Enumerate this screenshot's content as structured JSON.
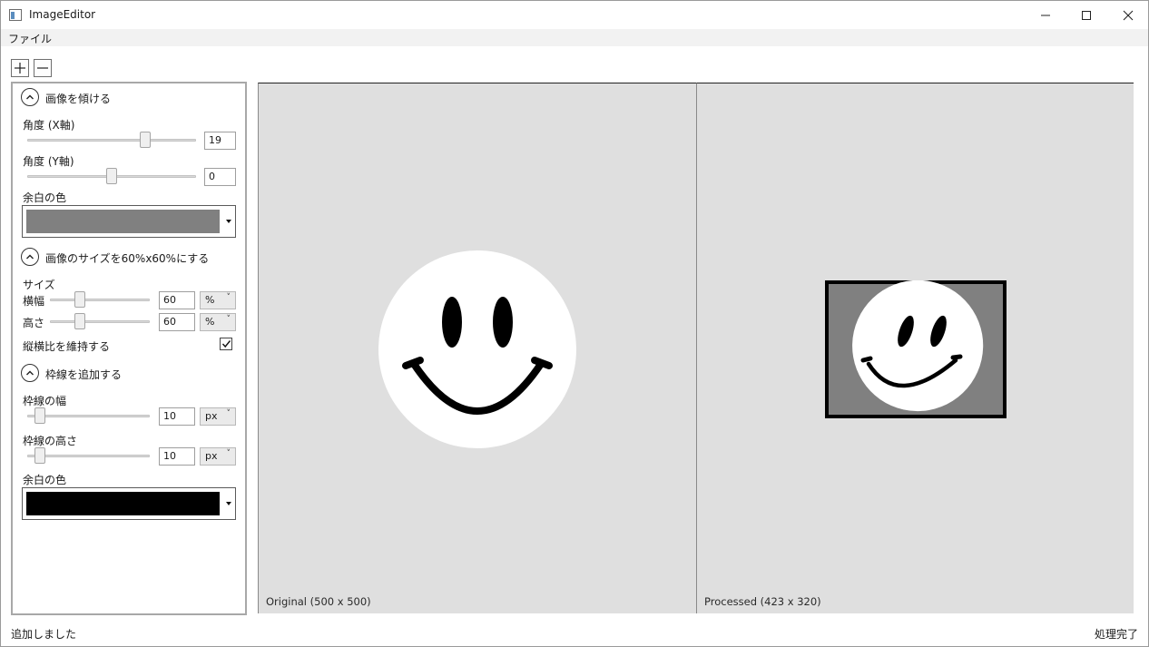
{
  "window": {
    "title": "ImageEditor",
    "icon": "app-window-icon",
    "controls": [
      "minimize-icon",
      "maximize-icon",
      "close-icon"
    ]
  },
  "menu": {
    "file": "ファイル"
  },
  "toolbar": {
    "add": "+",
    "remove": "−"
  },
  "panel": {
    "skew": {
      "title": "画像を傾ける",
      "angle_x_label": "角度 (X軸)",
      "angle_x_value": "19",
      "angle_x_slider": 0.71,
      "angle_y_label": "角度 (Y軸)",
      "angle_y_value": "0",
      "angle_y_slider": 0.5,
      "bg_label": "余白の色",
      "bg_color": "#808080"
    },
    "resize": {
      "title": "画像のサイズを60%x60%にする",
      "size_label": "サイズ",
      "width_label": "横幅",
      "width_value": "60",
      "width_unit": "%",
      "height_label": "高さ",
      "height_value": "60",
      "height_unit": "%",
      "keep_ratio_label": "縦横比を維持する",
      "keep_ratio_checked": true
    },
    "border": {
      "title": "枠線を追加する",
      "width_label": "枠線の幅",
      "width_value": "10",
      "width_unit": "px",
      "height_label": "枠線の高さ",
      "height_value": "10",
      "height_unit": "px",
      "bg_label": "余白の色",
      "bg_color": "#000000"
    }
  },
  "preview": {
    "original_caption": "Original (500 x 500)",
    "processed_caption": "Processed (423 x 320)"
  },
  "status": {
    "left": "追加しました",
    "right": "処理完了"
  }
}
